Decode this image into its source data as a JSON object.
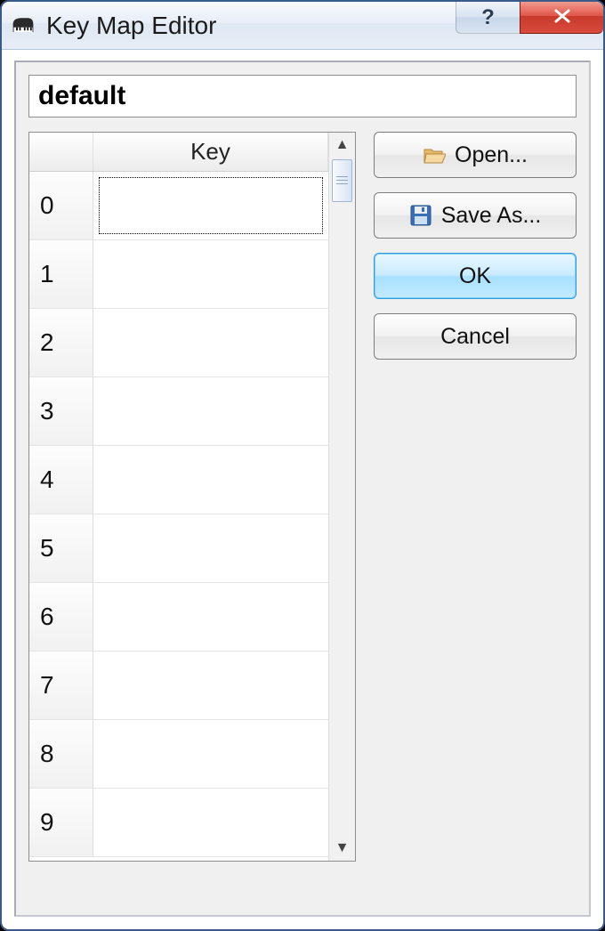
{
  "window": {
    "title": "Key Map Editor"
  },
  "name_field": "default",
  "table": {
    "header": {
      "key": "Key"
    },
    "rows": [
      {
        "index": "0",
        "key": ""
      },
      {
        "index": "1",
        "key": ""
      },
      {
        "index": "2",
        "key": ""
      },
      {
        "index": "3",
        "key": ""
      },
      {
        "index": "4",
        "key": ""
      },
      {
        "index": "5",
        "key": ""
      },
      {
        "index": "6",
        "key": ""
      },
      {
        "index": "7",
        "key": ""
      },
      {
        "index": "8",
        "key": ""
      },
      {
        "index": "9",
        "key": ""
      }
    ],
    "selected_row": 0
  },
  "buttons": {
    "open": "Open...",
    "save_as": "Save As...",
    "ok": "OK",
    "cancel": "Cancel"
  }
}
